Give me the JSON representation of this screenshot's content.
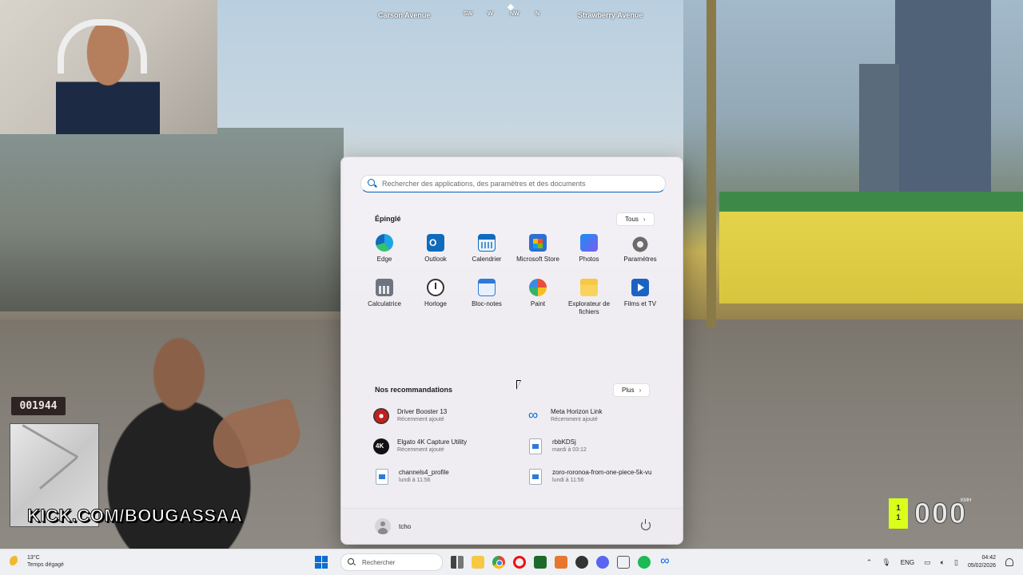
{
  "hud": {
    "street_left": "Carson Avenue",
    "street_right": "Strawberry Avenue",
    "compass": [
      "SW",
      "W",
      "NW",
      "N"
    ],
    "timer": "001944",
    "kick_url": "KICK.COM/BOUGASSAA",
    "gear": [
      "1",
      "1"
    ],
    "speed": "000",
    "speed_unit": "KMH"
  },
  "start_menu": {
    "search_placeholder": "Rechercher des applications, des paramètres et des documents",
    "pinned_title": "Épinglé",
    "all_button": "Tous",
    "pinned_apps": [
      {
        "label": "Edge",
        "icon": "edge-icon"
      },
      {
        "label": "Outlook",
        "icon": "outlook-icon"
      },
      {
        "label": "Calendrier",
        "icon": "calendar-icon"
      },
      {
        "label": "Microsoft Store",
        "icon": "store-icon"
      },
      {
        "label": "Photos",
        "icon": "photos-icon"
      },
      {
        "label": "Paramètres",
        "icon": "settings-gear-icon"
      },
      {
        "label": "Calculatrice",
        "icon": "calculator-icon"
      },
      {
        "label": "Horloge",
        "icon": "clock-icon"
      },
      {
        "label": "Bloc-notes",
        "icon": "notepad-icon"
      },
      {
        "label": "Paint",
        "icon": "paint-icon"
      },
      {
        "label": "Explorateur de fichiers",
        "icon": "folder-icon"
      },
      {
        "label": "Films et TV",
        "icon": "films-tv-icon"
      }
    ],
    "recommended_title": "Nos recommandations",
    "more_button": "Plus",
    "recommendations": [
      {
        "title": "Driver Booster 13",
        "subtitle": "Récemment ajouté",
        "icon": "driver-booster-icon"
      },
      {
        "title": "Meta Horizon Link",
        "subtitle": "Récemment ajouté",
        "icon": "meta-icon"
      },
      {
        "title": "Elgato 4K Capture Utility",
        "subtitle": "Récemment ajouté",
        "icon": "elgato-icon"
      },
      {
        "title": "rbbKDSj",
        "subtitle": "mardi à 03:12",
        "icon": "image-file-icon"
      },
      {
        "title": "channels4_profile",
        "subtitle": "lundi à 11:56",
        "icon": "image-file-icon"
      },
      {
        "title": "zoro-roronoa-from-one-piece-5k-vu",
        "subtitle": "lundi à 11:56",
        "icon": "image-file-icon"
      }
    ],
    "user_name": "tcho"
  },
  "taskbar": {
    "temperature": "13°C",
    "weather": "Temps dégagé",
    "search_label": "Rechercher",
    "language": "ENG",
    "time": "04:42",
    "date": "05/02/2026"
  }
}
